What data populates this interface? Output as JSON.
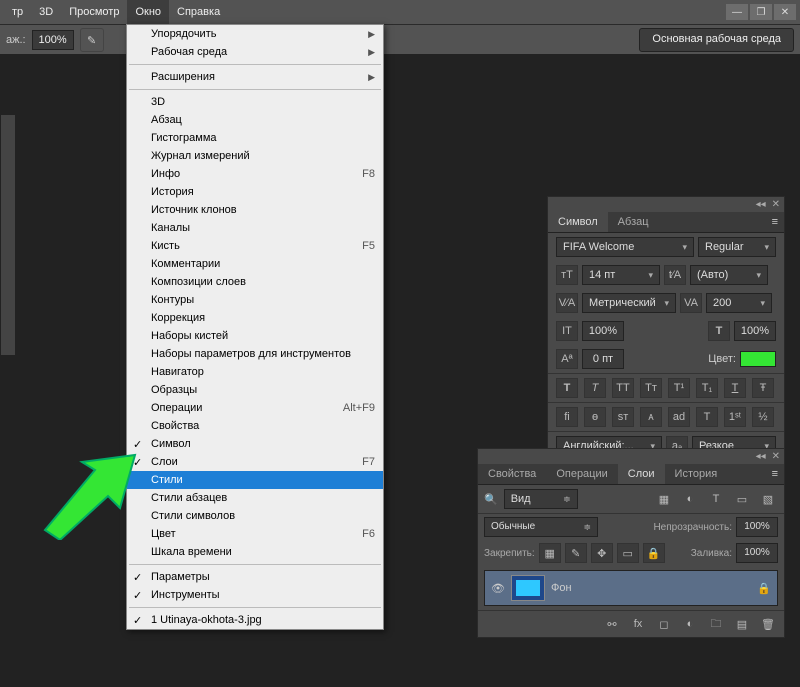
{
  "menubar": {
    "items": [
      "тр",
      "3D",
      "Просмотр",
      "Окно",
      "Справка"
    ],
    "open_index": 3
  },
  "window_controls": [
    "—",
    "❐",
    "✕"
  ],
  "toolbar": {
    "zoom_label": "аж.:",
    "zoom_value": "100%",
    "workspace_button": "Основная рабочая среда"
  },
  "menu": {
    "groups": [
      [
        {
          "label": "Упорядочить",
          "submenu": true
        },
        {
          "label": "Рабочая среда",
          "submenu": true
        }
      ],
      [
        {
          "label": "Расширения",
          "submenu": true
        }
      ],
      [
        {
          "label": "3D"
        },
        {
          "label": "Абзац"
        },
        {
          "label": "Гистограмма"
        },
        {
          "label": "Журнал измерений"
        },
        {
          "label": "Инфо",
          "shortcut": "F8"
        },
        {
          "label": "История"
        },
        {
          "label": "Источник клонов"
        },
        {
          "label": "Каналы"
        },
        {
          "label": "Кисть",
          "shortcut": "F5"
        },
        {
          "label": "Комментарии"
        },
        {
          "label": "Композиции слоев"
        },
        {
          "label": "Контуры"
        },
        {
          "label": "Коррекция"
        },
        {
          "label": "Наборы кистей"
        },
        {
          "label": "Наборы параметров для инструментов"
        },
        {
          "label": "Навигатор"
        },
        {
          "label": "Образцы"
        },
        {
          "label": "Операции",
          "shortcut": "Alt+F9"
        },
        {
          "label": "Свойства"
        },
        {
          "label": "Символ",
          "checked": true
        },
        {
          "label": "Слои",
          "checked": true,
          "shortcut": "F7"
        },
        {
          "label": "Стили",
          "highlight": true
        },
        {
          "label": "Стили абзацев"
        },
        {
          "label": "Стили символов"
        },
        {
          "label": "Цвет",
          "shortcut": "F6"
        },
        {
          "label": "Шкала времени"
        }
      ],
      [
        {
          "label": "Параметры",
          "checked": true
        },
        {
          "label": "Инструменты",
          "checked": true
        }
      ],
      [
        {
          "label": "1 Utinaya-okhota-3.jpg",
          "checked": true
        }
      ]
    ]
  },
  "character_panel": {
    "tabs": [
      "Символ",
      "Абзац"
    ],
    "active_tab": 0,
    "font": "FIFA Welcome",
    "style": "Regular",
    "size": "14 пт",
    "leading": "(Авто)",
    "kerning": "Метрический",
    "tracking": "200",
    "vscale": "100%",
    "hscale": "100%",
    "baseline": "0 пт",
    "color_label": "Цвет:",
    "color_hex": "#34e634",
    "language": "Английский:...",
    "aa": "Резкое"
  },
  "layers_panel": {
    "tabs": [
      "Свойства",
      "Операции",
      "Слои",
      "История"
    ],
    "active_tab": 2,
    "filter_kind": "Вид",
    "mode": "Обычные",
    "opacity_label": "Непрозрачность:",
    "opacity": "100%",
    "lock_label": "Закрепить:",
    "fill_label": "Заливка:",
    "fill": "100%",
    "layer_name": "Фон"
  }
}
